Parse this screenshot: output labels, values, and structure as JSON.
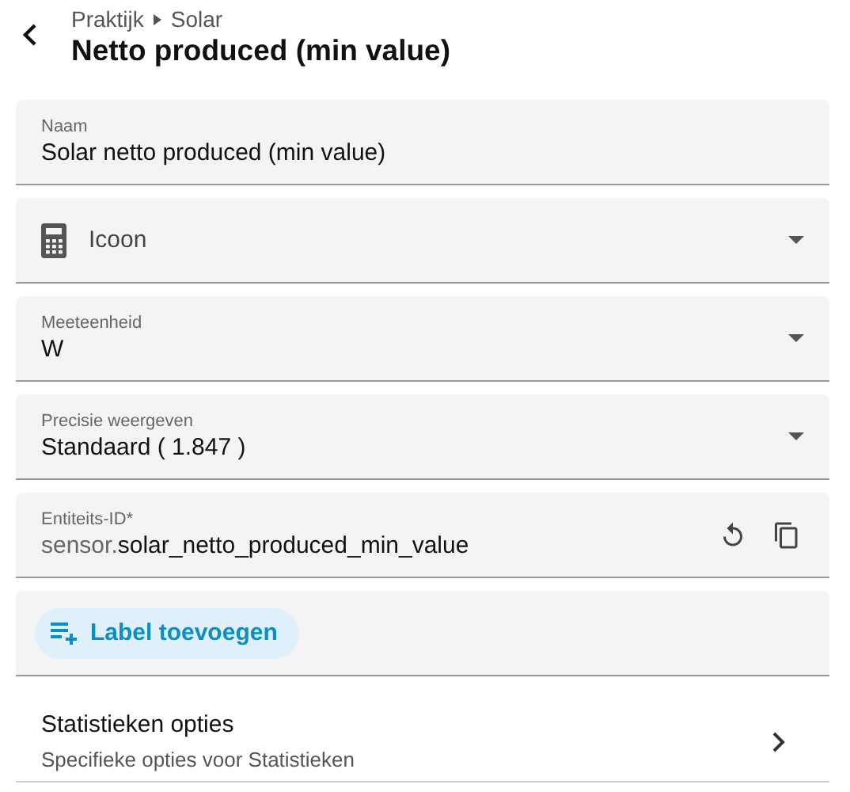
{
  "breadcrumb": [
    "Praktijk",
    "Solar"
  ],
  "title": "Netto produced (min value)",
  "fields": [
    {
      "kind": "text",
      "label": "Naam",
      "value": "Solar netto produced (min value)"
    },
    {
      "kind": "icon-select",
      "placeholder": "Icoon"
    },
    {
      "kind": "select",
      "label": "Meeteenheid",
      "value": "W"
    },
    {
      "kind": "select",
      "label": "Precisie weergeven",
      "value": "Standaard ( 1.847 )"
    },
    {
      "kind": "entity",
      "label": "Entiteits-ID*",
      "prefix": "sensor.",
      "value": "solar_netto_produced_min_value"
    }
  ],
  "label_button": "Label toevoegen",
  "statistics": {
    "title": "Statistieken opties",
    "subtitle": "Specifieke opties voor Statistieken"
  }
}
